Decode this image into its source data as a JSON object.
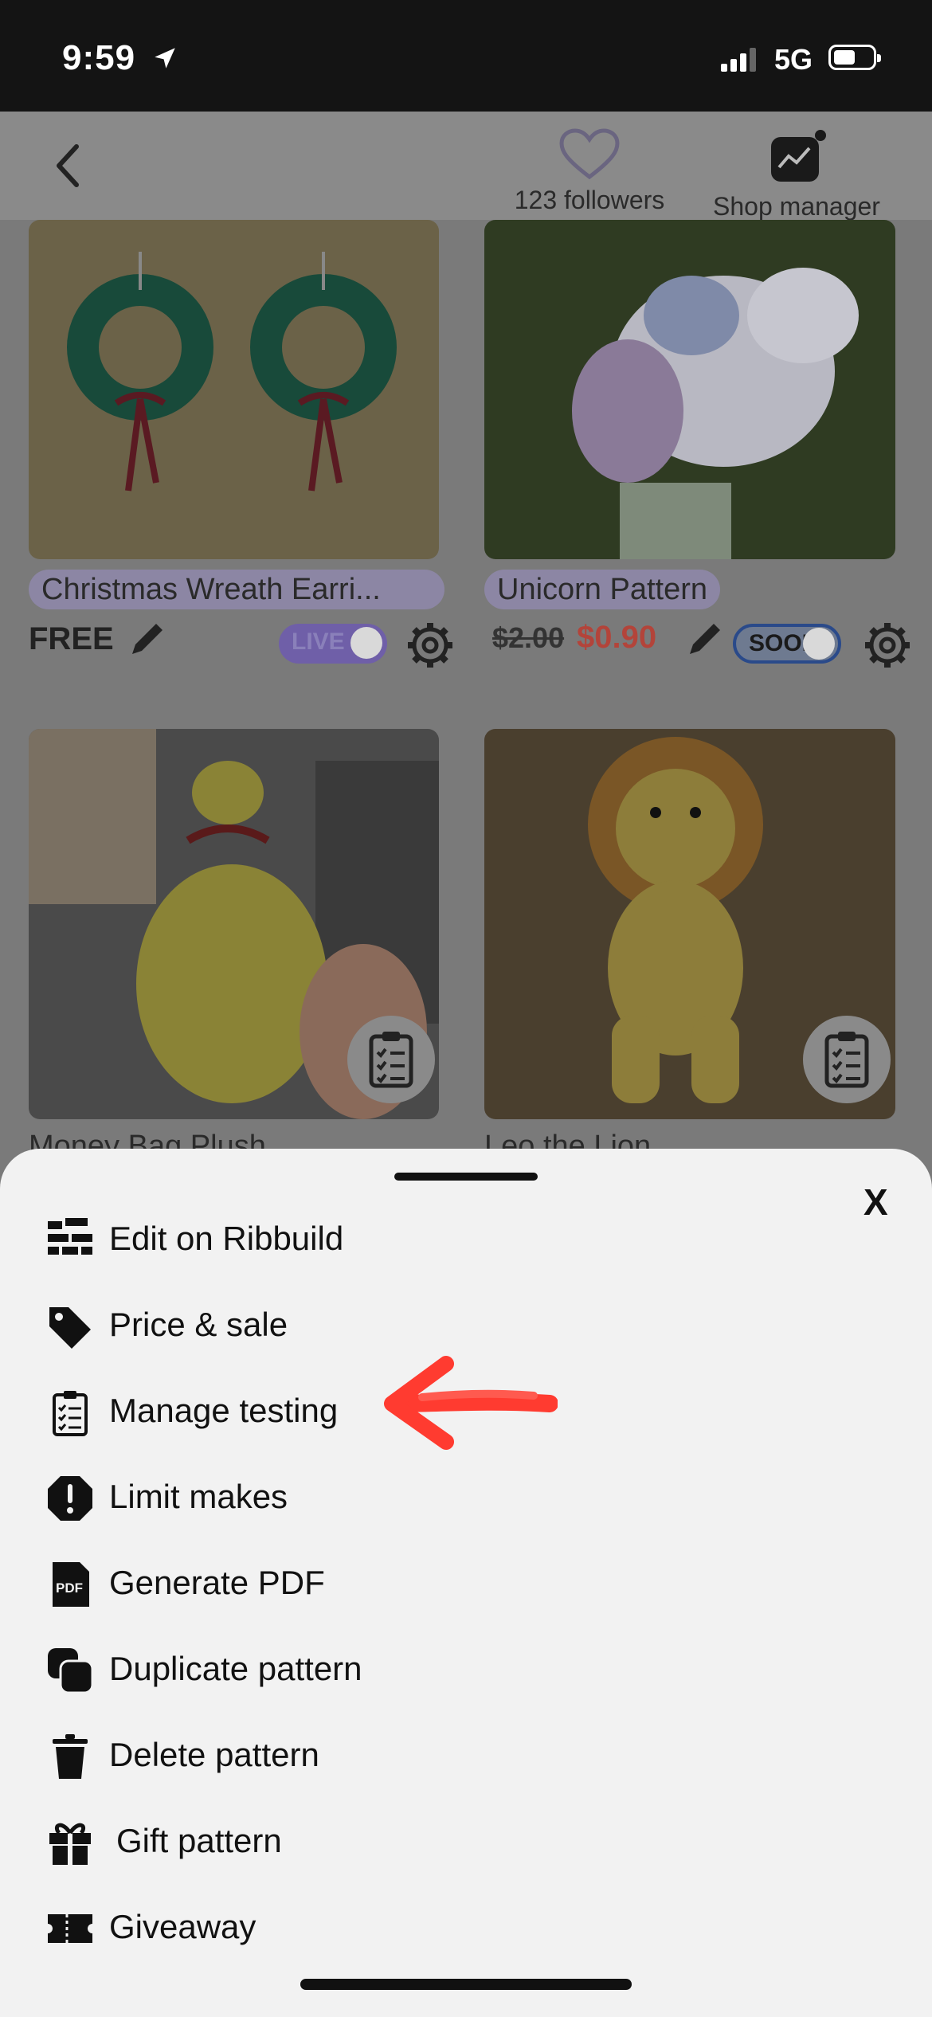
{
  "status_bar": {
    "time": "9:59",
    "network": "5G"
  },
  "header": {
    "back_icon": "chevron-left-icon",
    "followers_label": "123 followers",
    "shop_manager_label": "Shop manager"
  },
  "products": [
    {
      "title": "Christmas Wreath Earri...",
      "price": "FREE",
      "status": "LIVE"
    },
    {
      "title": "Unicorn Pattern",
      "old_price": "$2.00",
      "new_price": "$0.90",
      "status": "SOON"
    },
    {
      "title": "Money Bag Plush"
    },
    {
      "title": "Leo the Lion"
    }
  ],
  "sheet": {
    "close_label": "X",
    "items": [
      {
        "label": "Edit on Ribbuild",
        "icon": "ribbuild-icon"
      },
      {
        "label": "Price & sale",
        "icon": "price-tag-icon"
      },
      {
        "label": "Manage testing",
        "icon": "clipboard-checklist-icon"
      },
      {
        "label": "Limit makes",
        "icon": "exclamation-octagon-icon"
      },
      {
        "label": "Generate PDF",
        "icon": "pdf-icon"
      },
      {
        "label": "Duplicate pattern",
        "icon": "duplicate-icon"
      },
      {
        "label": "Delete pattern",
        "icon": "trash-icon"
      },
      {
        "label": "Gift pattern",
        "icon": "gift-icon"
      },
      {
        "label": "Giveaway",
        "icon": "ticket-icon"
      }
    ]
  },
  "colors": {
    "overlay": "#7a7a7a",
    "sheet": "#f2f2f2",
    "accent_purple": "#8c86a4",
    "sale_red": "#b3443a",
    "annotation_red": "#ff3b30"
  }
}
